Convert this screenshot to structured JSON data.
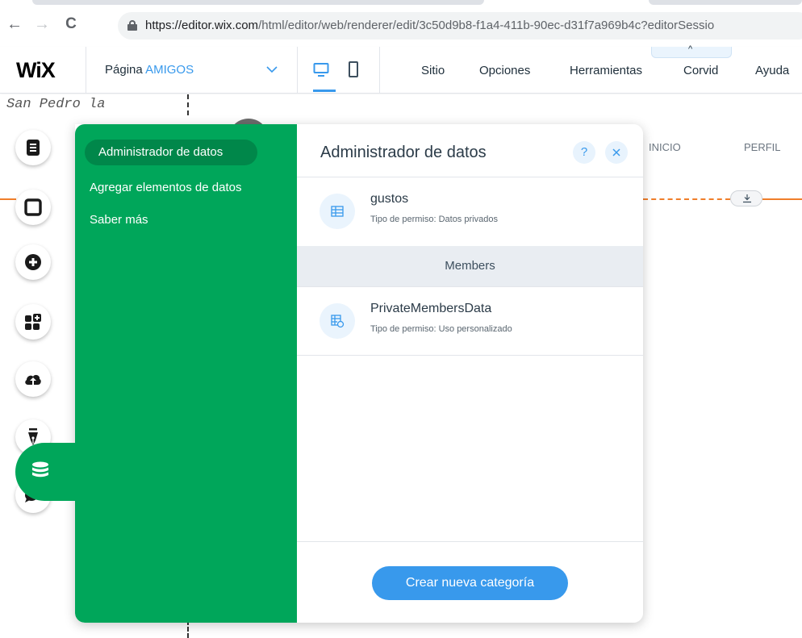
{
  "browser": {
    "url_host": "https://editor.wix.com",
    "url_path": "/html/editor/web/renderer/edit/3c50d9b8-f1a4-411b-90ec-d31f7a969b4c?editorSessio",
    "back_icon": "←",
    "forward_icon": "→",
    "reload_icon": "C"
  },
  "wix_bar": {
    "logo": "WiX",
    "page_prefix": "Página",
    "page_name": "AMIGOS",
    "menu": [
      "Sitio",
      "Opciones",
      "Herramientas",
      "Corvid",
      "Ayuda"
    ],
    "collapse_icon": "^"
  },
  "canvas": {
    "text": "San Pedro la",
    "links": [
      "INICIO",
      "PERFIL"
    ]
  },
  "rail": {
    "icons": [
      "pages-icon",
      "background-icon",
      "add-icon",
      "apps-icon",
      "upload-icon",
      "blog-icon",
      "chat-icon",
      "database-icon"
    ]
  },
  "panel": {
    "nav": [
      "Administrador de datos",
      "Agregar elementos de datos",
      "Saber más"
    ],
    "title": "Administrador de datos",
    "help": "?",
    "collections": [
      {
        "name": "gustos",
        "permission": "Tipo de permiso: Datos privados"
      }
    ],
    "section": "Members",
    "member_collections": [
      {
        "name": "PrivateMembersData",
        "permission": "Tipo de permiso: Uso personalizado"
      }
    ],
    "create_button": "Crear nueva categoría"
  },
  "colors": {
    "green": "#00a65a",
    "green_active": "#00874a",
    "blue": "#3899ec",
    "orange": "#f07e2a"
  }
}
